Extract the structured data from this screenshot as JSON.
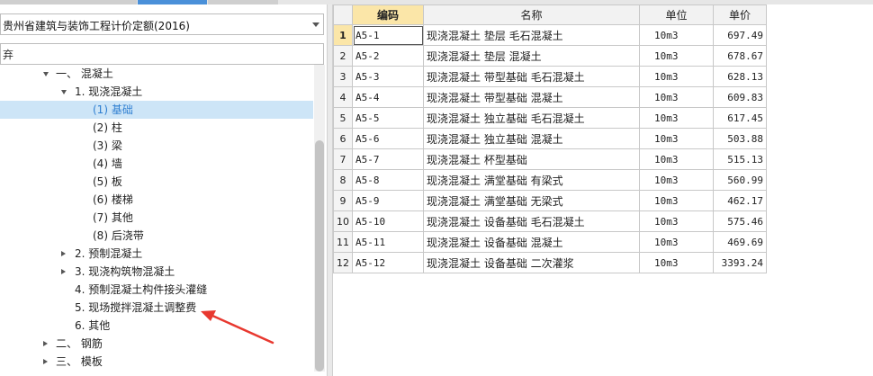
{
  "left_panel": {
    "dropdown_value": "贵州省建筑与装饰工程计价定额(2016)",
    "search_value": "弃",
    "tree": [
      {
        "label": "一、 混凝土",
        "state": "expanded"
      },
      {
        "label": "1. 现浇混凝土",
        "state": "expanded"
      },
      {
        "label": "(1) 基础",
        "state": "leaf",
        "selected": true
      },
      {
        "label": "(2) 柱",
        "state": "leaf"
      },
      {
        "label": "(3) 梁",
        "state": "leaf"
      },
      {
        "label": "(4) 墙",
        "state": "leaf"
      },
      {
        "label": "(5) 板",
        "state": "leaf"
      },
      {
        "label": "(6) 楼梯",
        "state": "leaf"
      },
      {
        "label": "(7) 其他",
        "state": "leaf"
      },
      {
        "label": "(8) 后浇带",
        "state": "leaf"
      },
      {
        "label": "2. 预制混凝土",
        "state": "collapsed"
      },
      {
        "label": "3. 现浇构筑物混凝土",
        "state": "collapsed"
      },
      {
        "label": "4. 预制混凝土构件接头灌缝",
        "state": "leaf"
      },
      {
        "label": "5. 现场搅拌混凝土调整费",
        "state": "leaf"
      },
      {
        "label": "6. 其他",
        "state": "leaf"
      },
      {
        "label": "二、 钢筋",
        "state": "collapsed"
      },
      {
        "label": "三、 模板",
        "state": "collapsed"
      }
    ]
  },
  "grid": {
    "columns": [
      "",
      "编码",
      "名称",
      "单位",
      "单价"
    ],
    "rows": [
      {
        "no": "1",
        "code": "A5-1",
        "name": "现浇混凝土 垫层 毛石混凝土",
        "unit": "10m3",
        "price": "697.49"
      },
      {
        "no": "2",
        "code": "A5-2",
        "name": "现浇混凝土 垫层 混凝土",
        "unit": "10m3",
        "price": "678.67"
      },
      {
        "no": "3",
        "code": "A5-3",
        "name": "现浇混凝土 带型基础 毛石混凝土",
        "unit": "10m3",
        "price": "628.13"
      },
      {
        "no": "4",
        "code": "A5-4",
        "name": "现浇混凝土 带型基础 混凝土",
        "unit": "10m3",
        "price": "609.83"
      },
      {
        "no": "5",
        "code": "A5-5",
        "name": "现浇混凝土 独立基础 毛石混凝土",
        "unit": "10m3",
        "price": "617.45"
      },
      {
        "no": "6",
        "code": "A5-6",
        "name": "现浇混凝土 独立基础 混凝土",
        "unit": "10m3",
        "price": "503.88"
      },
      {
        "no": "7",
        "code": "A5-7",
        "name": "现浇混凝土 杯型基础",
        "unit": "10m3",
        "price": "515.13"
      },
      {
        "no": "8",
        "code": "A5-8",
        "name": "现浇混凝土 满堂基础 有梁式",
        "unit": "10m3",
        "price": "560.99"
      },
      {
        "no": "9",
        "code": "A5-9",
        "name": "现浇混凝土 满堂基础 无梁式",
        "unit": "10m3",
        "price": "462.17"
      },
      {
        "no": "10",
        "code": "A5-10",
        "name": "现浇混凝土 设备基础 毛石混凝土",
        "unit": "10m3",
        "price": "575.46"
      },
      {
        "no": "11",
        "code": "A5-11",
        "name": "现浇混凝土 设备基础 混凝土",
        "unit": "10m3",
        "price": "469.69"
      },
      {
        "no": "12",
        "code": "A5-12",
        "name": "现浇混凝土 设备基础 二次灌浆",
        "unit": "10m3",
        "price": "3393.24"
      }
    ]
  },
  "colors": {
    "selection": "#cde5f7",
    "selection_text": "#2f7fd1",
    "header_highlight": "#fbe6a8",
    "annotation_arrow": "#e8382f",
    "tab_active": "#4a90d9"
  }
}
